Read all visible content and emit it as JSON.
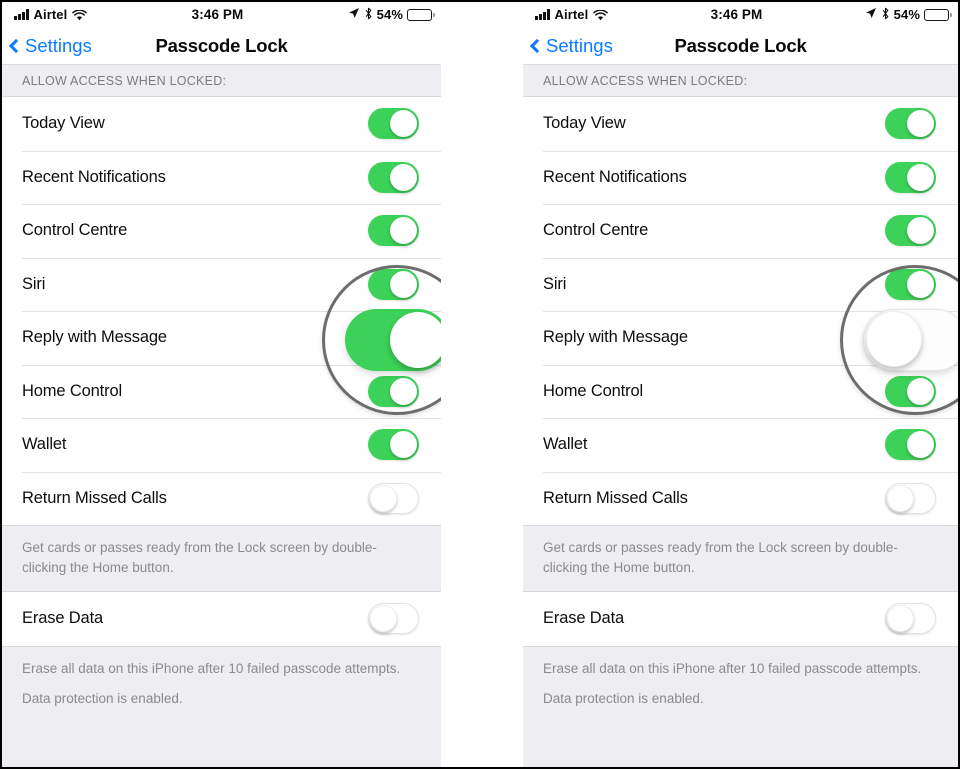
{
  "status_bar": {
    "carrier": "Airtel",
    "signal_icon": "signal-bars-icon",
    "wifi_icon": "wifi-icon",
    "time": "3:46 PM",
    "location_icon": "location-arrow-icon",
    "bluetooth_icon": "bluetooth-icon",
    "battery_percent": "54%",
    "battery_icon": "battery-icon",
    "battery_level": 54
  },
  "nav": {
    "back_label": "Settings",
    "back_icon": "chevron-left-icon",
    "title": "Passcode Lock",
    "accent_color": "#0a7cff"
  },
  "section": {
    "header": "ALLOW ACCESS WHEN LOCKED:"
  },
  "colors": {
    "switch_on": "#3cd158",
    "switch_off": "#ffffff",
    "group_background": "#eeeef2",
    "magnifier_ring": "#6d6d6d"
  },
  "panels": [
    {
      "id": "before",
      "rows": [
        {
          "label": "Today View",
          "state": "on"
        },
        {
          "label": "Recent Notifications",
          "state": "on"
        },
        {
          "label": "Control Centre",
          "state": "on"
        },
        {
          "label": "Siri",
          "state": "on"
        },
        {
          "label": "Reply with Message",
          "state": "on"
        },
        {
          "label": "Home Control",
          "state": "on"
        },
        {
          "label": "Wallet",
          "state": "on"
        },
        {
          "label": "Return Missed Calls",
          "state": "off"
        }
      ],
      "wallet_footnote_line1": "Get cards or passes ready from the Lock screen by double-",
      "wallet_footnote_line2": "clicking the Home button.",
      "erase_row": {
        "label": "Erase Data",
        "state": "off"
      },
      "erase_footnote_line1": "Erase all data on this iPhone after 10 failed",
      "erase_footnote_line2": "passcode attempts.",
      "erase_footnote_line3": "Data protection is enabled.",
      "magnifier": {
        "target_row": "Reply with Message",
        "state": "on"
      }
    },
    {
      "id": "after",
      "rows": [
        {
          "label": "Today View",
          "state": "on"
        },
        {
          "label": "Recent Notifications",
          "state": "on"
        },
        {
          "label": "Control Centre",
          "state": "on"
        },
        {
          "label": "Siri",
          "state": "on"
        },
        {
          "label": "Reply with Message",
          "state": "off"
        },
        {
          "label": "Home Control",
          "state": "on"
        },
        {
          "label": "Wallet",
          "state": "on"
        },
        {
          "label": "Return Missed Calls",
          "state": "off"
        }
      ],
      "wallet_footnote_line1": "Get cards or passes ready from the Lock screen by double-",
      "wallet_footnote_line2": "clicking the Home button.",
      "erase_row": {
        "label": "Erase Data",
        "state": "off"
      },
      "erase_footnote_line1": "Erase all data on this iPhone after 10 failed",
      "erase_footnote_line2": "passcode attempts.",
      "erase_footnote_line3": "Data protection is enabled.",
      "magnifier": {
        "target_row": "Reply with Message",
        "state": "off"
      }
    }
  ]
}
